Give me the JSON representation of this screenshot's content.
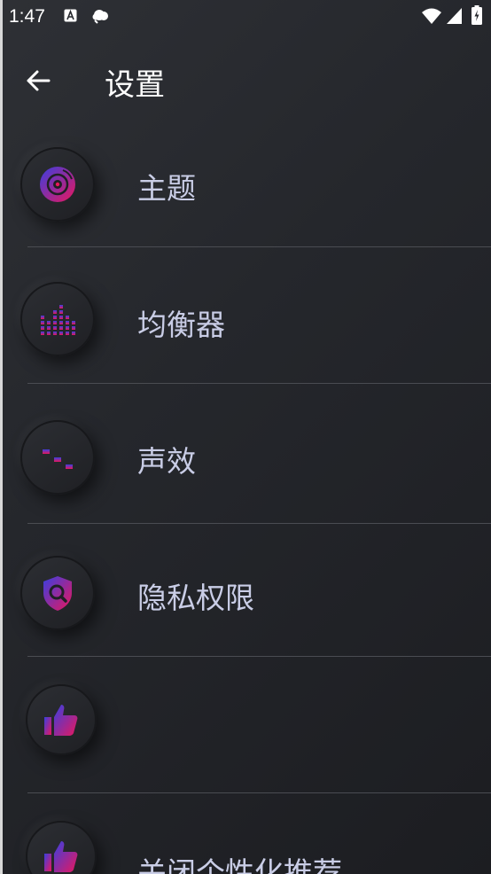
{
  "status_bar": {
    "time": "1:47",
    "icons": [
      "a-icon",
      "cloud-icon",
      "wifi-icon",
      "signal-icon",
      "battery-icon"
    ]
  },
  "app_bar": {
    "back_icon": "arrow-left-icon",
    "title": "设置"
  },
  "settings": {
    "items": [
      {
        "label": "主题",
        "icon": "vinyl-disc-icon"
      },
      {
        "label": "均衡器",
        "icon": "equalizer-bars-icon"
      },
      {
        "label": "声效",
        "icon": "sliders-icon"
      },
      {
        "label": "隐私权限",
        "icon": "shield-search-icon"
      },
      {
        "label": "",
        "icon": "thumbs-up-icon"
      },
      {
        "label": "关闭个性化推荐",
        "icon": "thumbs-up-icon"
      }
    ]
  },
  "colors": {
    "background": "#25272c",
    "title_text": "#ffffff",
    "item_text": "#c9cde6",
    "gradient_start": "#3a3fe0",
    "gradient_end": "#e8175d",
    "divider": "#4a4c52"
  }
}
